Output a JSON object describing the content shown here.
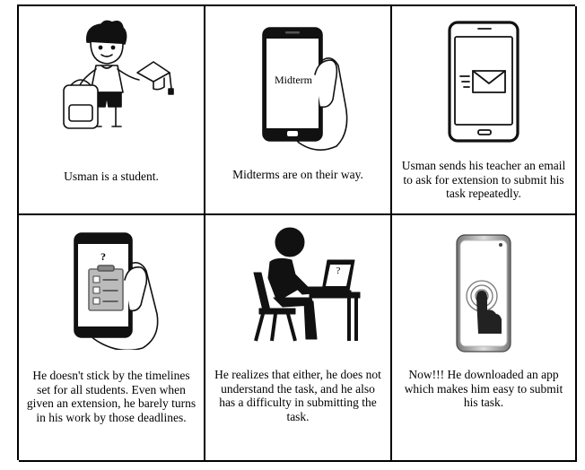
{
  "panels": [
    {
      "caption": "Usman is a student."
    },
    {
      "caption": "Midterms are on their way.",
      "phone_text": "Midterm"
    },
    {
      "caption": "Usman sends his teacher an email to ask for extension to submit his task repeatedly."
    },
    {
      "caption": "He doesn't stick by the timelines set for all students. Even when given an extension, he barely turns in his work by those deadlines.",
      "phone_text": "?"
    },
    {
      "caption": "He realizes that either, he does not understand the task, and he also has a difficulty in submitting the task.",
      "screen_text": "?"
    },
    {
      "caption": "Now!!! He downloaded an app which makes him easy to submit his task."
    }
  ],
  "icons": [
    "student-icon",
    "phone-in-hand-icon",
    "email-phone-icon",
    "checklist-phone-icon",
    "person-at-laptop-icon",
    "touchscreen-phone-icon"
  ]
}
